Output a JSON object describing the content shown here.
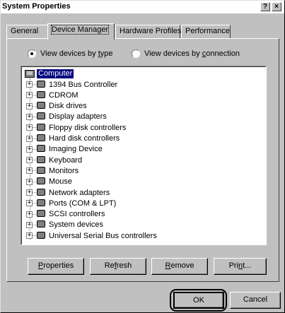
{
  "window": {
    "title": "System Properties",
    "help_label": "?",
    "close_label": "×"
  },
  "tabs": [
    {
      "label": "General",
      "active": false
    },
    {
      "label": "Device Manager",
      "active": true
    },
    {
      "label": "Hardware Profiles",
      "active": false
    },
    {
      "label": "Performance",
      "active": false
    }
  ],
  "view_options": {
    "by_type": {
      "label_pre": "View devices by ",
      "label_key": "t",
      "label_post": "ype",
      "checked": true
    },
    "by_connection": {
      "label_pre": "View devices by ",
      "label_key": "c",
      "label_post": "onnection",
      "checked": false
    }
  },
  "tree": {
    "root": {
      "label": "Computer",
      "icon": "computer-icon",
      "selected": true
    },
    "items": [
      {
        "label": "1394 Bus Controller",
        "icon": "bus-controller-icon"
      },
      {
        "label": "CDROM",
        "icon": "cdrom-icon"
      },
      {
        "label": "Disk drives",
        "icon": "disk-drive-icon"
      },
      {
        "label": "Display adapters",
        "icon": "display-adapter-icon"
      },
      {
        "label": "Floppy disk controllers",
        "icon": "floppy-controller-icon"
      },
      {
        "label": "Hard disk controllers",
        "icon": "hard-disk-controller-icon"
      },
      {
        "label": "Imaging Device",
        "icon": "imaging-device-icon"
      },
      {
        "label": "Keyboard",
        "icon": "keyboard-icon"
      },
      {
        "label": "Monitors",
        "icon": "monitor-icon"
      },
      {
        "label": "Mouse",
        "icon": "mouse-icon"
      },
      {
        "label": "Network adapters",
        "icon": "network-adapter-icon"
      },
      {
        "label": "Ports (COM & LPT)",
        "icon": "port-icon"
      },
      {
        "label": "SCSI controllers",
        "icon": "scsi-controller-icon"
      },
      {
        "label": "System devices",
        "icon": "system-device-icon"
      },
      {
        "label": "Universal Serial Bus controllers",
        "icon": "usb-icon"
      }
    ],
    "expander": "+"
  },
  "panel_buttons": {
    "properties": {
      "pre": "",
      "key": "P",
      "post": "roperties"
    },
    "refresh": {
      "pre": "Re",
      "key": "f",
      "post": "resh"
    },
    "remove": {
      "pre": "",
      "key": "R",
      "post": "emove"
    },
    "print": {
      "pre": "Pri",
      "key": "n",
      "post": "t..."
    }
  },
  "dialog_buttons": {
    "ok": "OK",
    "cancel": "Cancel"
  },
  "colors": {
    "face": "#c0c0c0",
    "selection": "#000080"
  }
}
